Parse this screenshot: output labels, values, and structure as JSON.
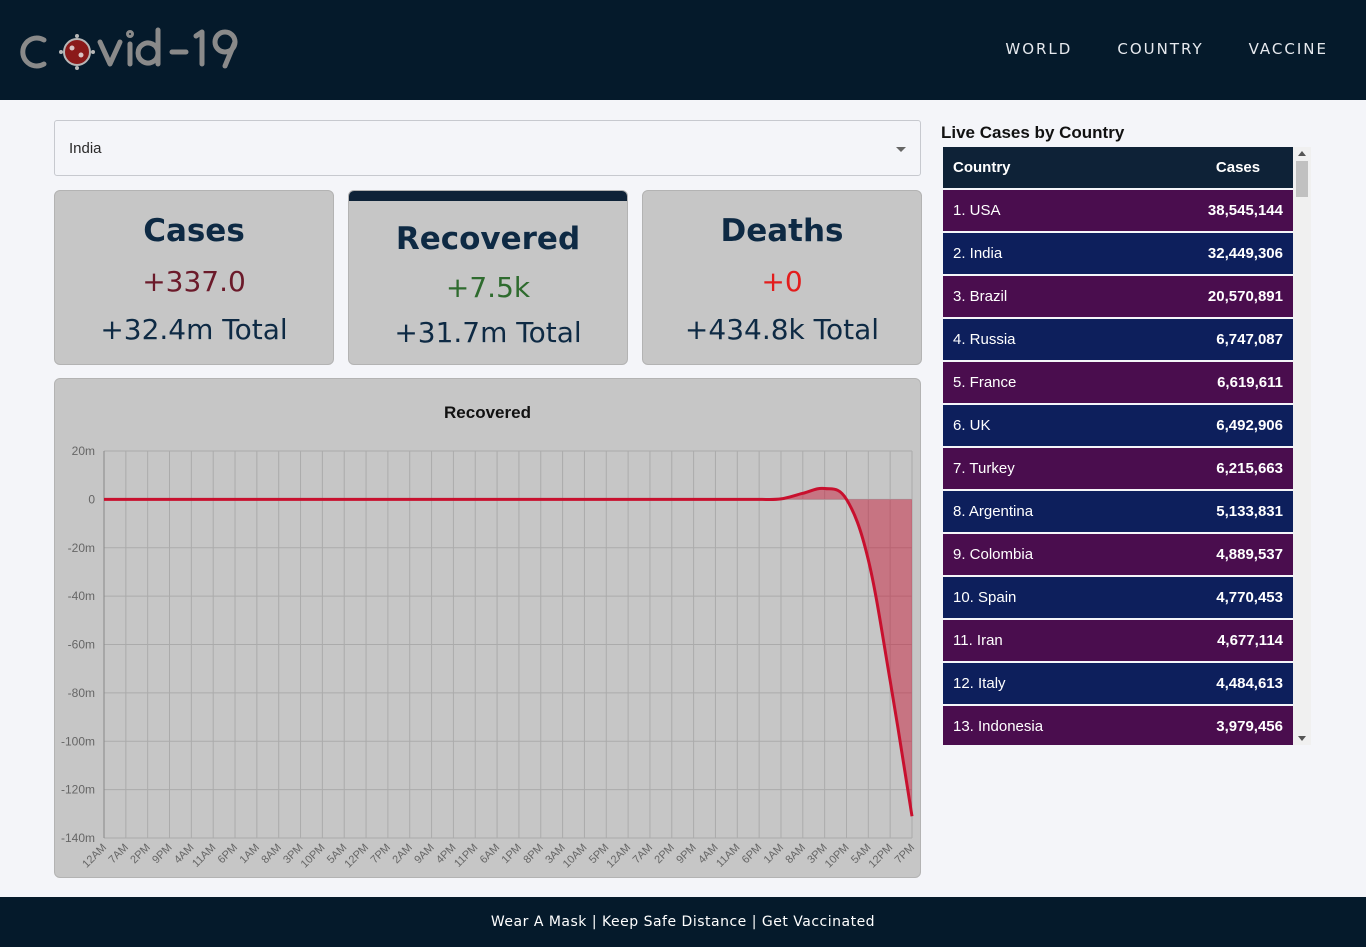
{
  "header": {
    "logo_text": "covid-19",
    "nav": [
      "WORLD",
      "COUNTRY",
      "VACCINE"
    ]
  },
  "selector": {
    "value": "India"
  },
  "cards": {
    "cases": {
      "title": "Cases",
      "delta": "+337.0",
      "total": "+32.4m Total",
      "delta_color": "#6b1a2a"
    },
    "recovered": {
      "title": "Recovered",
      "delta": "+7.5k",
      "total": "+31.7m Total",
      "delta_color": "#2e6b2e"
    },
    "deaths": {
      "title": "Deaths",
      "delta": "+0",
      "total": "+434.8k Total",
      "delta_color": "#e31c1c"
    }
  },
  "chart_data": {
    "type": "area",
    "title": "Recovered",
    "xlabel": "",
    "ylabel": "",
    "ylim": [
      -140,
      20
    ],
    "yticks": [
      "20m",
      "0",
      "-20m",
      "-40m",
      "-60m",
      "-80m",
      "-100m",
      "-120m",
      "-140m"
    ],
    "x": [
      "12AM",
      "7AM",
      "2PM",
      "9PM",
      "4AM",
      "11AM",
      "6PM",
      "1AM",
      "8AM",
      "3PM",
      "10PM",
      "5AM",
      "12PM",
      "7PM",
      "2AM",
      "9AM",
      "4PM",
      "11PM",
      "6AM",
      "1PM",
      "8PM",
      "3AM",
      "10AM",
      "5PM",
      "12AM",
      "7AM",
      "2PM",
      "9PM",
      "4AM",
      "11AM",
      "6PM",
      "1AM",
      "8AM",
      "3PM",
      "10PM",
      "5AM",
      "12PM",
      "7PM"
    ],
    "series": [
      {
        "values": [
          0,
          0,
          0,
          0,
          0,
          0,
          0,
          0,
          0,
          0,
          0,
          0,
          0,
          0,
          0,
          0,
          0,
          0,
          0,
          0,
          0,
          0,
          0,
          0,
          0,
          0,
          0,
          0,
          0,
          0,
          0,
          0.2,
          2.5,
          4.5,
          0,
          -25,
          -75,
          -131
        ],
        "color": "#c8102e",
        "fill": "rgba(200,16,46,0.45)"
      }
    ],
    "grid": true
  },
  "live": {
    "title": "Live Cases by Country",
    "headers": [
      "Country",
      "Cases"
    ],
    "rows": [
      {
        "country": "1. USA",
        "cases": "38,545,144"
      },
      {
        "country": "2. India",
        "cases": "32,449,306"
      },
      {
        "country": "3. Brazil",
        "cases": "20,570,891"
      },
      {
        "country": "4. Russia",
        "cases": "6,747,087"
      },
      {
        "country": "5. France",
        "cases": "6,619,611"
      },
      {
        "country": "6. UK",
        "cases": "6,492,906"
      },
      {
        "country": "7. Turkey",
        "cases": "6,215,663"
      },
      {
        "country": "8. Argentina",
        "cases": "5,133,831"
      },
      {
        "country": "9. Colombia",
        "cases": "4,889,537"
      },
      {
        "country": "10. Spain",
        "cases": "4,770,453"
      },
      {
        "country": "11. Iran",
        "cases": "4,677,114"
      },
      {
        "country": "12. Italy",
        "cases": "4,484,613"
      },
      {
        "country": "13. Indonesia",
        "cases": "3,979,456"
      }
    ]
  },
  "footer": {
    "text": "Wear A Mask | Keep Safe Distance | Get Vaccinated"
  }
}
